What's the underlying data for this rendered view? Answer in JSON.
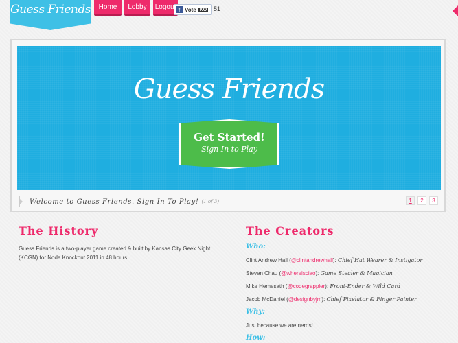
{
  "header": {
    "logo_text": "Guess Friends",
    "nav": [
      {
        "label": "Home"
      },
      {
        "label": "Lobby"
      },
      {
        "label": "Logout"
      }
    ],
    "vote": {
      "label": "Vote",
      "ko_badge": "KO",
      "count": "51"
    }
  },
  "hero": {
    "title": "Guess Friends",
    "cta_main": "Get Started!",
    "cta_sub": "Sign In to Play",
    "caption": "Welcome to Guess Friends. Sign In To Play!",
    "caption_count": "(1 of 3)",
    "pages": [
      "1",
      "2",
      "3"
    ],
    "active_page": "1"
  },
  "history": {
    "heading": "The History",
    "text": "Guess Friends is a two-player game created & built by Kansas City Geek Night (KCGN) for Node Knockout 2011 in 48 hours."
  },
  "creators": {
    "heading": "The Creators",
    "who_label": "Who:",
    "people": [
      {
        "name": "Clint Andrew Hall (",
        "handle": "@clintandrewhall",
        "close": "):",
        "role": "Chief Hat Wearer & Instigator"
      },
      {
        "name": "Steven Chau (",
        "handle": "@whereisciao",
        "close": "):",
        "role": "Game Stealer & Magician"
      },
      {
        "name": "Mike Hemesath (",
        "handle": "@codegrappler",
        "close": "):",
        "role": "Front-Ender & Wild Card"
      },
      {
        "name": "Jacob McDaniel (",
        "handle": "@designbyjm",
        "close": "):",
        "role": "Chief Pixelator & Finger Painter"
      }
    ],
    "why_label": "Why:",
    "why_text": "Just because we are nerds!",
    "how_label": "How:"
  },
  "colors": {
    "accent_pink": "#ee2a6b",
    "accent_blue": "#3ec0e6",
    "cta_green": "#4dbc4a"
  },
  "icons": {
    "vote_fb": "facebook-icon",
    "edge": "arrow-left-icon"
  }
}
